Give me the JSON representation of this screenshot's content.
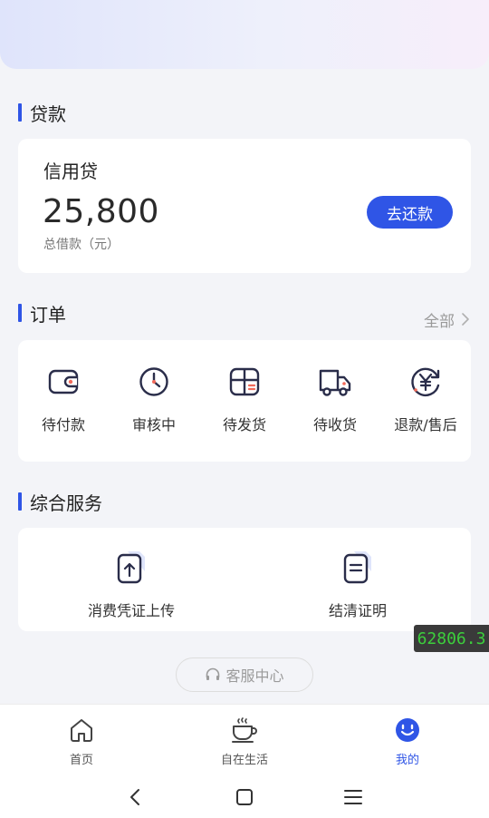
{
  "loans": {
    "section_title": "贷款",
    "product_name": "信用贷",
    "amount": "25,800",
    "amount_caption": "总借款（元）",
    "repay_label": "去还款"
  },
  "orders": {
    "section_title": "订单",
    "all_label": "全部",
    "items": [
      {
        "label": "待付款",
        "icon": "wallet-icon"
      },
      {
        "label": "审核中",
        "icon": "clock-icon"
      },
      {
        "label": "待发货",
        "icon": "package-icon"
      },
      {
        "label": "待收货",
        "icon": "truck-icon"
      },
      {
        "label": "退款/售后",
        "icon": "yen-refund-icon"
      }
    ]
  },
  "services": {
    "section_title": "综合服务",
    "items": [
      {
        "label": "消费凭证上传",
        "icon": "upload-document-icon"
      },
      {
        "label": "结清证明",
        "icon": "certificate-document-icon"
      }
    ]
  },
  "overlay_badge": "62806.3",
  "customer_service_label": "客服中心",
  "bottom_nav": {
    "items": [
      {
        "label": "首页",
        "icon": "home-icon",
        "active": false
      },
      {
        "label": "自在生活",
        "icon": "coffee-icon",
        "active": false
      },
      {
        "label": "我的",
        "icon": "smile-icon",
        "active": true
      }
    ]
  },
  "colors": {
    "accent": "#2f55e6",
    "icon_stroke": "#2a2d4a",
    "background": "#f3f4f8",
    "badge_text": "#3ccf3c"
  }
}
